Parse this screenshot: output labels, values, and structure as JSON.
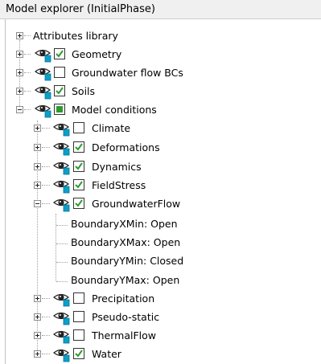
{
  "window": {
    "title": "Model explorer (InitialPhase)"
  },
  "tree": {
    "attributes_library": "Attributes library",
    "geometry": {
      "label": "Geometry",
      "checked": true
    },
    "groundwater_flow_bcs": {
      "label": "Groundwater flow BCs",
      "checked": false
    },
    "soils": {
      "label": "Soils",
      "checked": true
    },
    "model_conditions": {
      "label": "Model conditions",
      "state": "partial",
      "children": {
        "climate": {
          "label": "Climate",
          "checked": false
        },
        "deformations": {
          "label": "Deformations",
          "checked": true
        },
        "dynamics": {
          "label": "Dynamics",
          "checked": true
        },
        "fieldstress": {
          "label": "FieldStress",
          "checked": true
        },
        "groundwaterflow": {
          "label": "GroundwaterFlow",
          "checked": true,
          "properties": [
            "BoundaryXMin: Open",
            "BoundaryXMax: Open",
            "BoundaryYMin: Closed",
            "BoundaryYMax: Open"
          ]
        },
        "precipitation": {
          "label": "Precipitation",
          "checked": false
        },
        "pseudo_static": {
          "label": "Pseudo-static",
          "checked": false
        },
        "thermalflow": {
          "label": "ThermalFlow",
          "checked": false
        },
        "water": {
          "label": "Water",
          "checked": true
        }
      }
    }
  },
  "colors": {
    "check_green": "#2e9a2e",
    "eye_teal": "#0aa0c8"
  }
}
